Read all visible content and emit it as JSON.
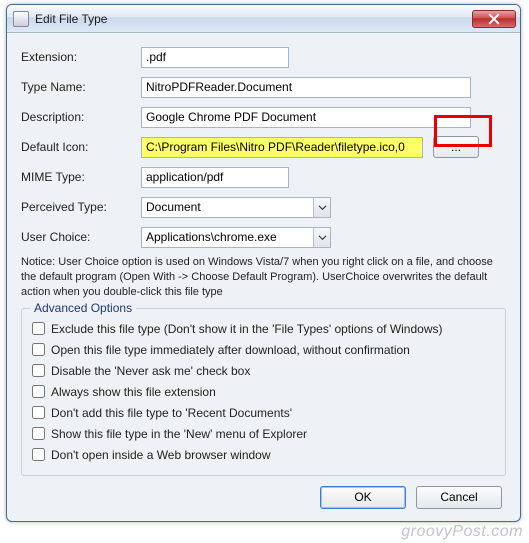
{
  "window": {
    "title": "Edit File Type"
  },
  "form": {
    "extension_label": "Extension:",
    "extension_value": ".pdf",
    "typename_label": "Type Name:",
    "typename_value": "NitroPDFReader.Document",
    "description_label": "Description:",
    "description_value": "Google Chrome PDF Document",
    "defaulticon_label": "Default Icon:",
    "defaulticon_value": "C:\\Program Files\\Nitro PDF\\Reader\\filetype.ico,0",
    "browse_label": "...",
    "mimetype_label": "MIME Type:",
    "mimetype_value": "application/pdf",
    "perceived_label": "Perceived Type:",
    "perceived_value": "Document",
    "userchoice_label": "User Choice:",
    "userchoice_value": "Applications\\chrome.exe"
  },
  "notice": "Notice: User Choice option is used on Windows Vista/7 when you right click on a file, and choose the default program (Open With -> Choose Default Program). UserChoice overwrites the default action when you double-click this file type",
  "advanced": {
    "title": "Advanced Options",
    "items": [
      "Exclude  this file type (Don't show it in the 'File Types' options of Windows)",
      "Open this file type immediately after download, without confirmation",
      "Disable the 'Never ask me' check box",
      "Always show this file extension",
      "Don't add this file type to 'Recent Documents'",
      "Show this file type in the 'New' menu of Explorer",
      "Don't open inside a Web browser window"
    ]
  },
  "buttons": {
    "ok": "OK",
    "cancel": "Cancel"
  },
  "watermark": "groovyPost.com"
}
